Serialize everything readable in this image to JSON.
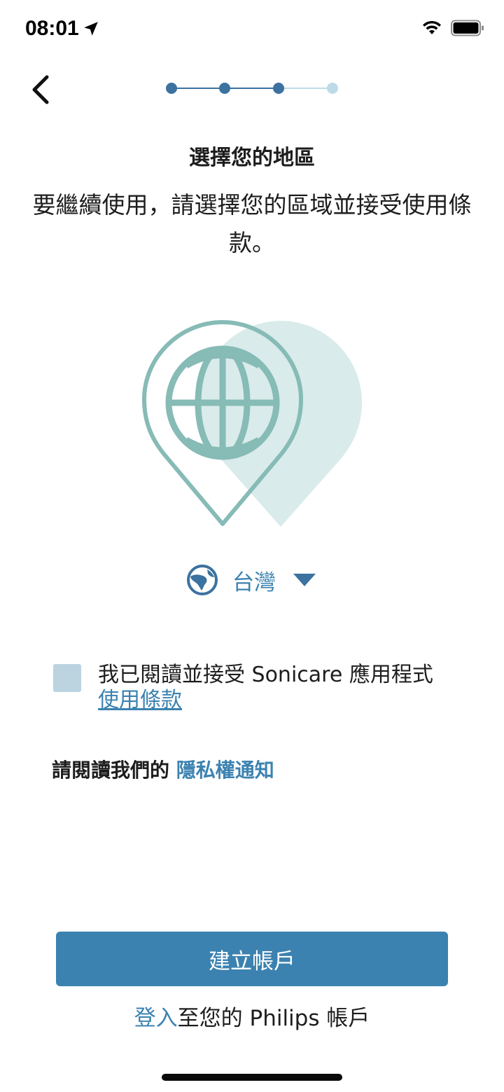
{
  "status_bar": {
    "time": "08:01"
  },
  "progress": {
    "total_steps": 4,
    "current_step": 3
  },
  "page": {
    "title": "選擇您的地區",
    "subtitle": "要繼續使用，請選擇您的區域並接受使用條款。"
  },
  "region": {
    "selected": "台灣"
  },
  "terms": {
    "text_prefix": "我已閱讀並接受 Sonicare 應用程式",
    "link_label": "使用條款",
    "checked": false
  },
  "privacy": {
    "prefix": "請閱讀我們的 ",
    "link_label": "隱私權通知"
  },
  "actions": {
    "create_account_label": "建立帳戶",
    "signin_link_label": "登入",
    "signin_suffix": "至您的 Philips 帳戶"
  },
  "colors": {
    "accent": "#3b82b0",
    "illustration": "#86bbb6",
    "illustration_light": "#d9ebea",
    "checkbox": "#bcd3e0"
  }
}
